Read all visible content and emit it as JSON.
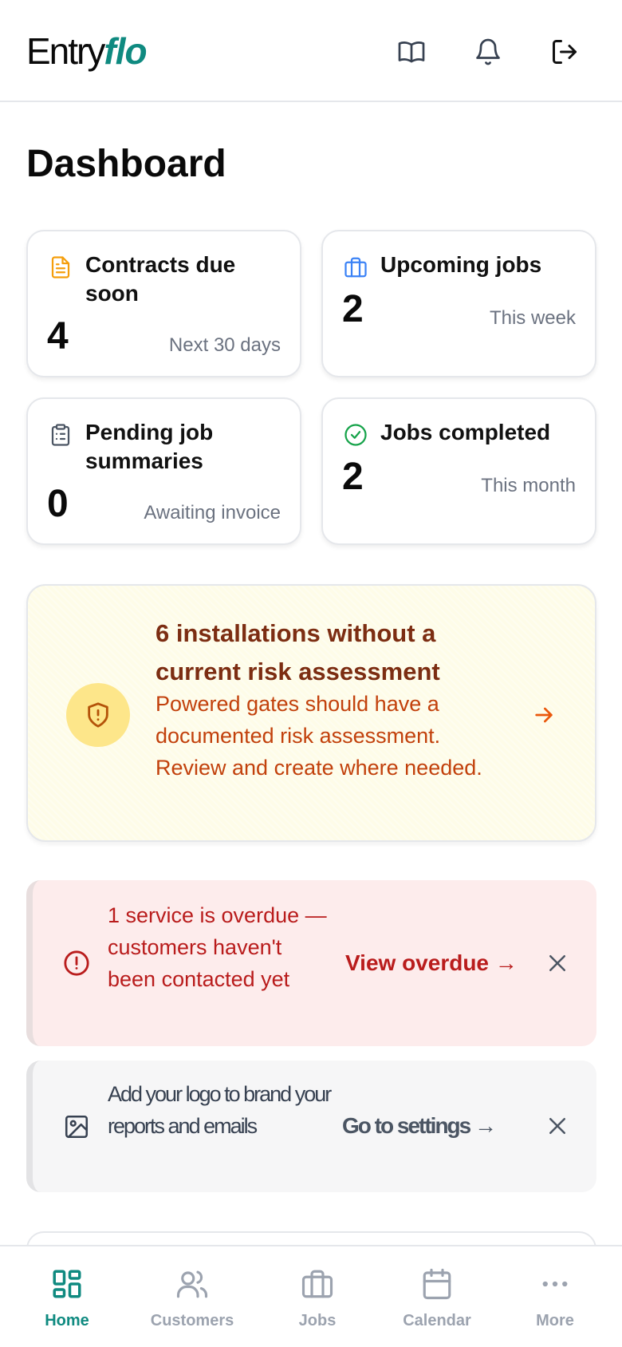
{
  "header": {
    "logo_main": "Entry",
    "logo_accent": "flo",
    "icons": [
      "book-icon",
      "bell-icon",
      "logout-icon"
    ]
  },
  "page": {
    "title": "Dashboard"
  },
  "stats": [
    {
      "title": "Contracts due soon",
      "value": "4",
      "sub": "Next 30 days",
      "icon": "document-icon",
      "color": "#f59e0b"
    },
    {
      "title": "Upcoming jobs",
      "value": "2",
      "sub": "This week",
      "icon": "briefcase-icon",
      "color": "#3b82f6"
    },
    {
      "title": "Pending job summaries",
      "value": "0",
      "sub": "Awaiting invoice",
      "icon": "clipboard-icon",
      "color": "#4b5563"
    },
    {
      "title": "Jobs completed",
      "value": "2",
      "sub": "This month",
      "icon": "check-circle-icon",
      "color": "#16a34a"
    }
  ],
  "risk": {
    "title": "6 installations without a current risk assessment",
    "body": "Powered gates should have a documented risk assessment. Review and create where needed.",
    "icon": "shield-alert-icon"
  },
  "alerts": {
    "overdue": {
      "text": "1 service is overdue — customers haven't been contacted yet",
      "link": "View overdue →",
      "icon": "alert-circle-icon"
    },
    "logo": {
      "text": "Add your logo to brand your reports and emails",
      "link": "Go to settings →",
      "icon": "image-icon"
    }
  },
  "nav": [
    {
      "label": "Home",
      "icon": "grid-icon",
      "active": true
    },
    {
      "label": "Customers",
      "icon": "users-icon",
      "active": false
    },
    {
      "label": "Jobs",
      "icon": "briefcase-icon",
      "active": false
    },
    {
      "label": "Calendar",
      "icon": "calendar-icon",
      "active": false
    },
    {
      "label": "More",
      "icon": "more-icon",
      "active": false
    }
  ],
  "colors": {
    "brand": "#0f8a80",
    "warning_text": "#7c2d12",
    "warning_body": "#c2410c",
    "danger": "#b91c1c"
  }
}
